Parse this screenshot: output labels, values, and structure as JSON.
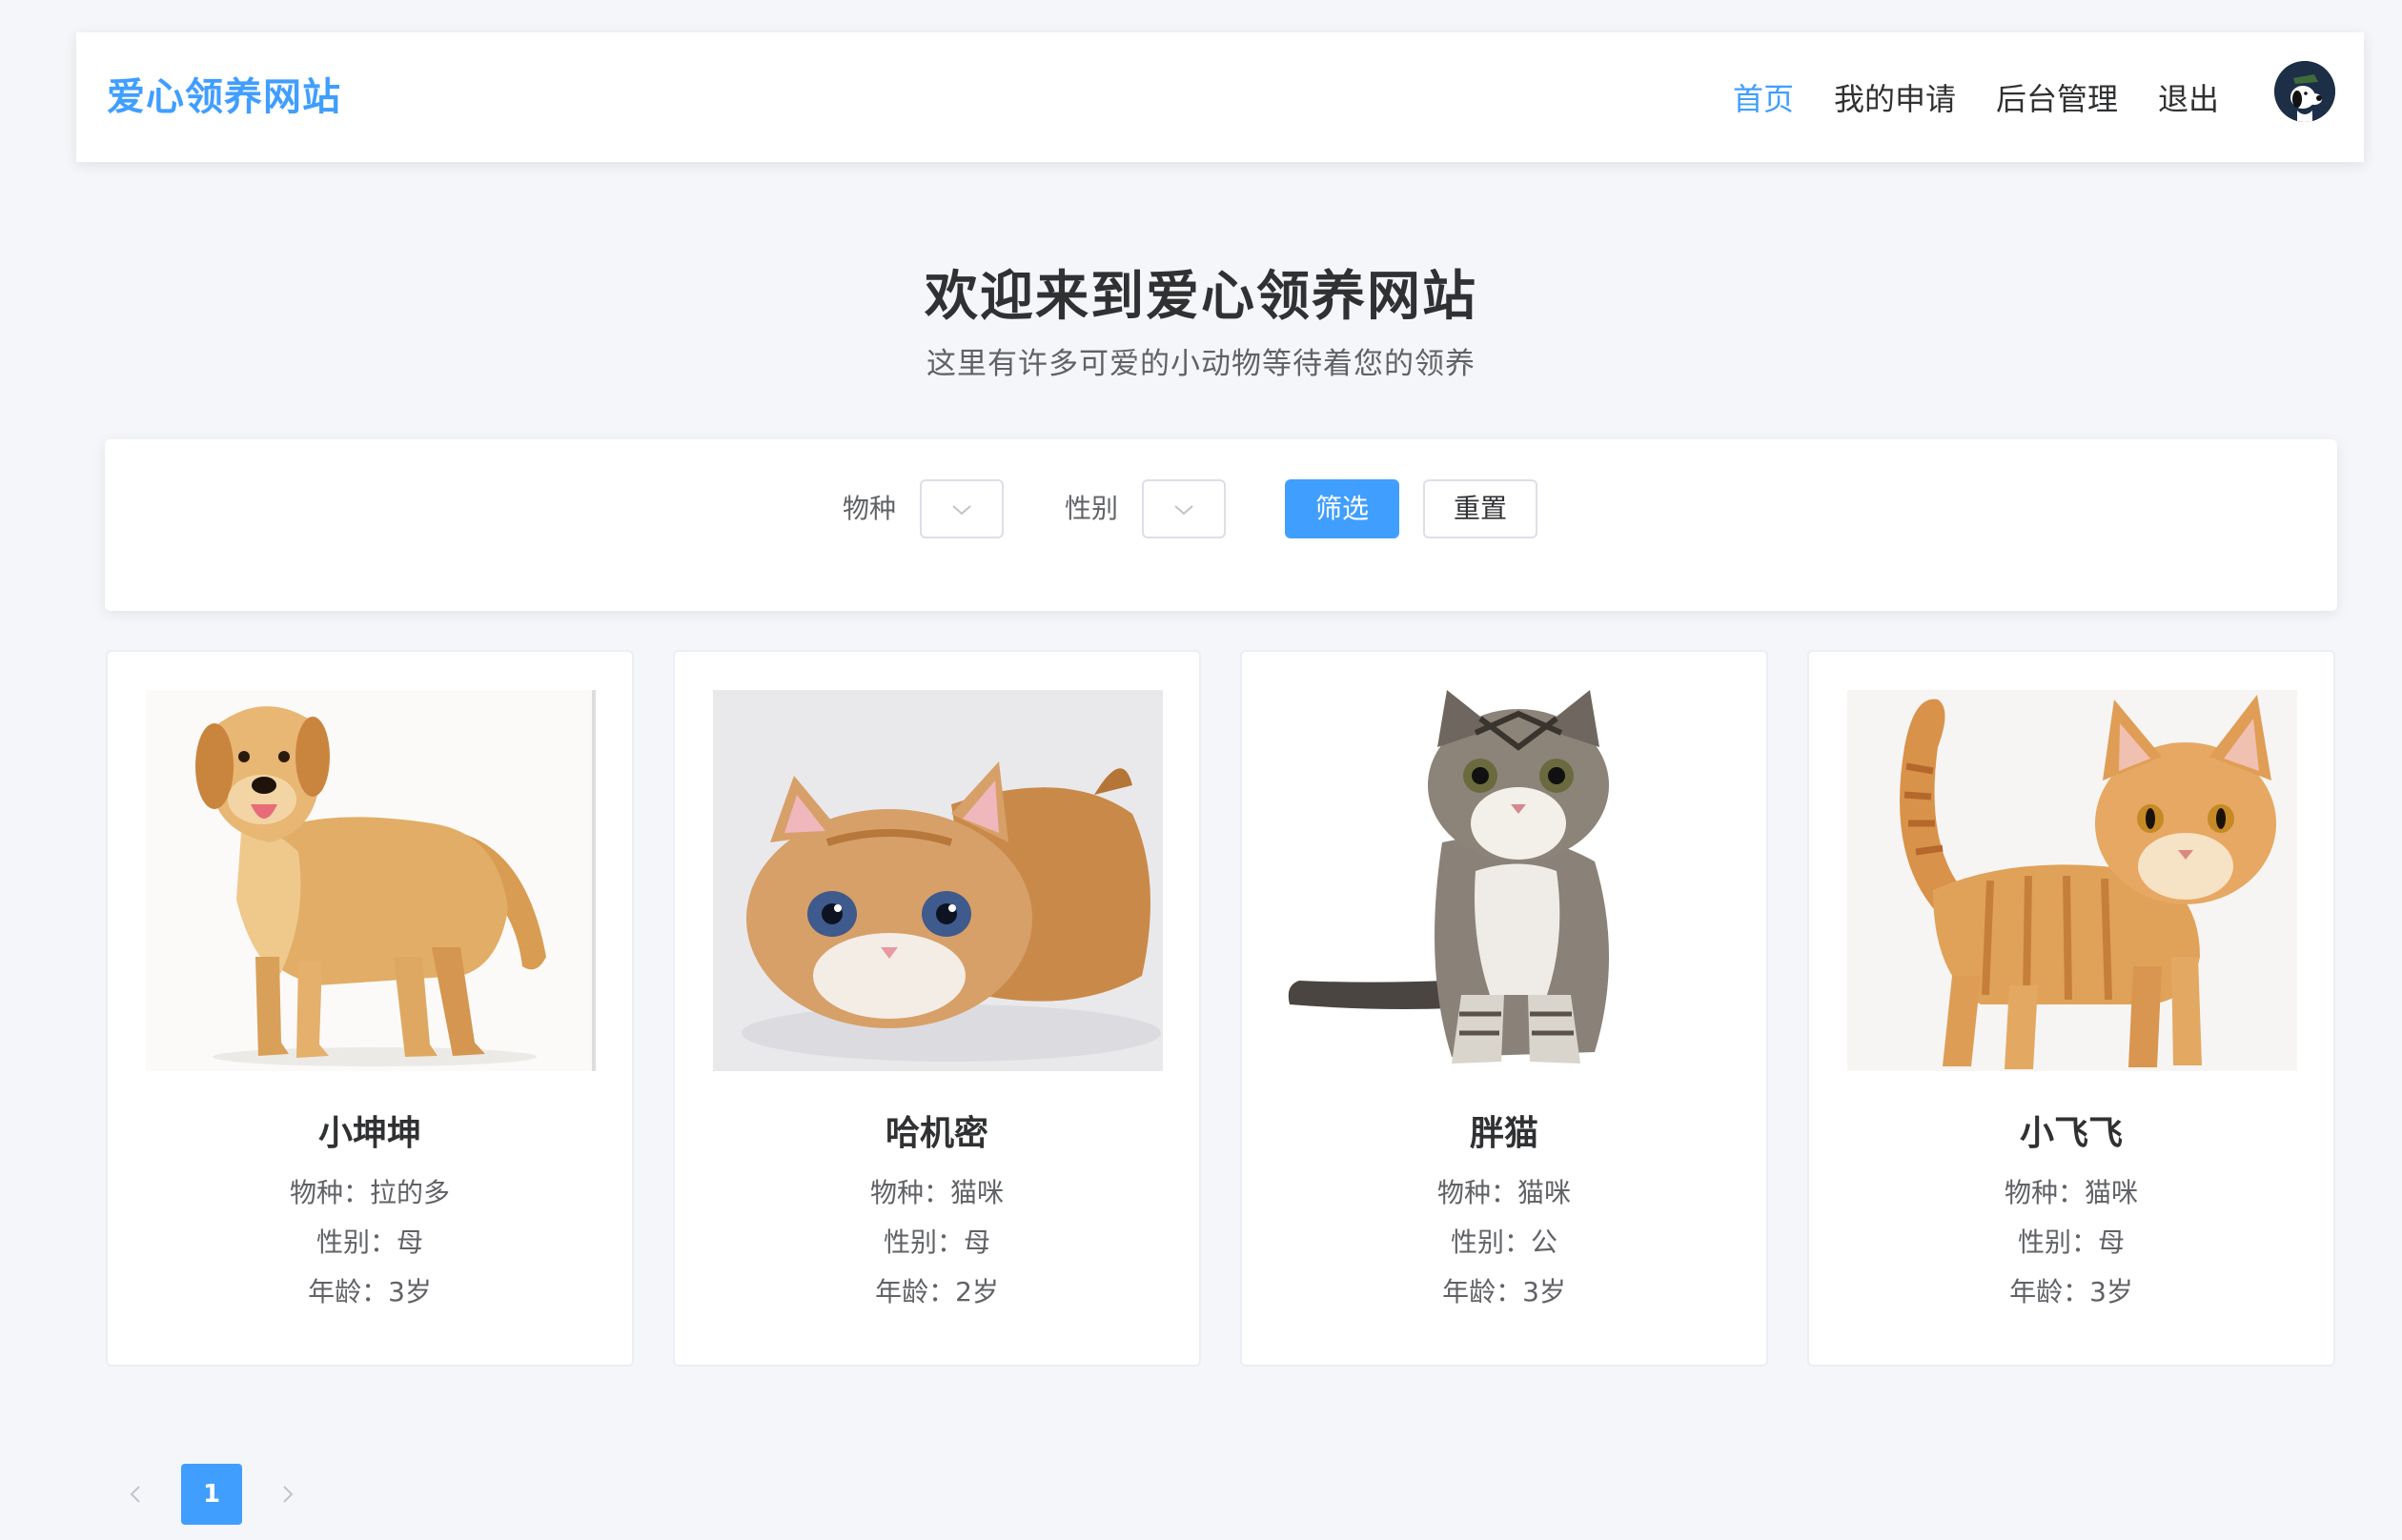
{
  "header": {
    "brand": "爱心领养网站",
    "nav": [
      {
        "label": "首页",
        "active": true
      },
      {
        "label": "我的申请",
        "active": false
      },
      {
        "label": "后台管理",
        "active": false
      },
      {
        "label": "退出",
        "active": false
      }
    ],
    "avatar_icon": "snoopy-avatar"
  },
  "hero": {
    "title": "欢迎来到爱心领养网站",
    "subtitle": "这里有许多可爱的小动物等待着您的领养"
  },
  "filter": {
    "species_label": "物种",
    "species_value": "",
    "gender_label": "性别",
    "gender_value": "",
    "filter_button": "筛选",
    "reset_button": "重置"
  },
  "pets": [
    {
      "name": "小坤坤",
      "species": "物种：拉的多",
      "gender": "性别：母",
      "age": "年龄：3岁",
      "photo": "golden-retriever"
    },
    {
      "name": "哈机密",
      "species": "物种：猫咪",
      "gender": "性别：母",
      "age": "年龄：2岁",
      "photo": "orange-kitten"
    },
    {
      "name": "胖猫",
      "species": "物种：猫咪",
      "gender": "性别：公",
      "age": "年龄：3岁",
      "photo": "tabby-kitten"
    },
    {
      "name": "小飞飞",
      "species": "物种：猫咪",
      "gender": "性别：母",
      "age": "年龄：3岁",
      "photo": "orange-cat"
    }
  ],
  "pagination": {
    "prev_icon": "chevron-left-icon",
    "current_page": "1",
    "next_icon": "chevron-right-icon"
  },
  "colors": {
    "accent": "#409eff",
    "page_bg": "#f5f6f9",
    "text": "#303133",
    "muted": "#606266"
  }
}
